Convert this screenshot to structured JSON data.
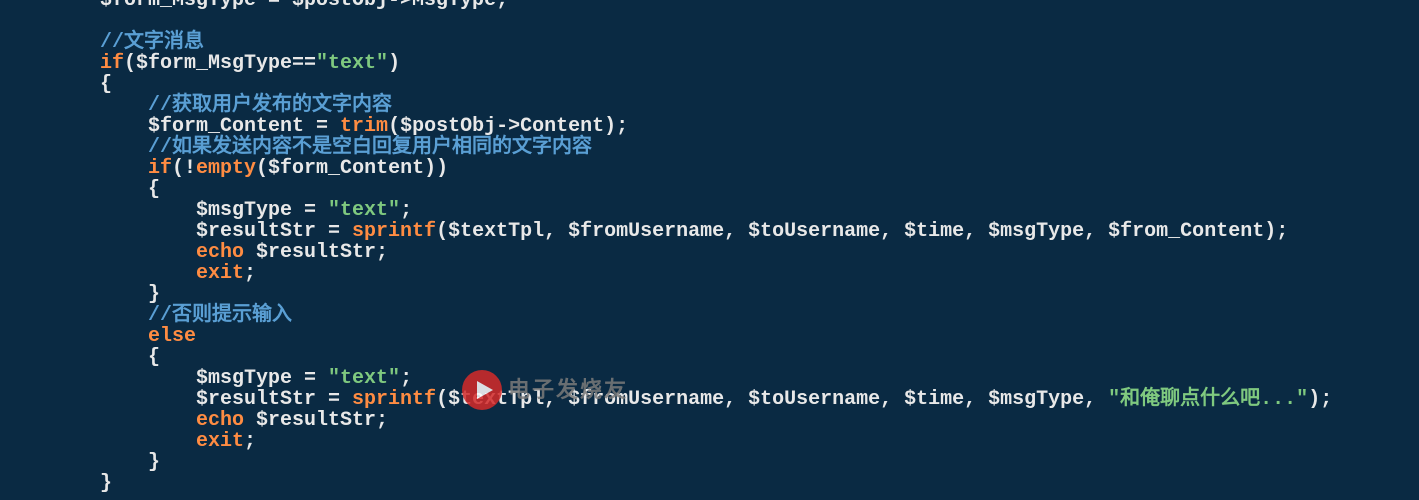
{
  "code": {
    "l00a": "$form_MsgType = $postObj->MsgType;",
    "l00b": "",
    "l01": "//文字消息",
    "l02_a": "if",
    "l02_b": "($form_MsgType==",
    "l02_c": "\"text\"",
    "l02_d": ")",
    "l03": "{",
    "l04": "    //获取用户发布的文字内容",
    "l05_a": "    $form_Content = ",
    "l05_b": "trim",
    "l05_c": "($postObj->Content);",
    "l06": "    //如果发送内容不是空白回复用户相同的文字内容",
    "l07_a": "    if",
    "l07_b": "(!",
    "l07_c": "empty",
    "l07_d": "($form_Content))",
    "l08": "    {",
    "l09_a": "        $msgType = ",
    "l09_b": "\"text\"",
    "l09_c": ";",
    "l10_a": "        $resultStr = ",
    "l10_b": "sprintf",
    "l10_c": "($textTpl, $fromUsername, $toUsername, $time, $msgType, $from_Content);",
    "l11_a": "        echo",
    "l11_b": " $resultStr;",
    "l12_a": "        exit",
    "l12_b": ";",
    "l13": "    }",
    "l14": "    //否则提示输入",
    "l15": "    else",
    "l16": "    {",
    "l17_a": "        $msgType = ",
    "l17_b": "\"text\"",
    "l17_c": ";",
    "l18_a": "        $resultStr = ",
    "l18_b": "sprintf",
    "l18_c": "($textTpl, $fromUsername, $toUsername, $time, $msgType, ",
    "l18_d": "\"和俺聊点什么吧...\"",
    "l18_e": ");",
    "l19_a": "        echo",
    "l19_b": " $resultStr;",
    "l20_a": "        exit",
    "l20_b": ";",
    "l21": "    }",
    "l22": "}"
  },
  "watermark": "电子发烧友"
}
